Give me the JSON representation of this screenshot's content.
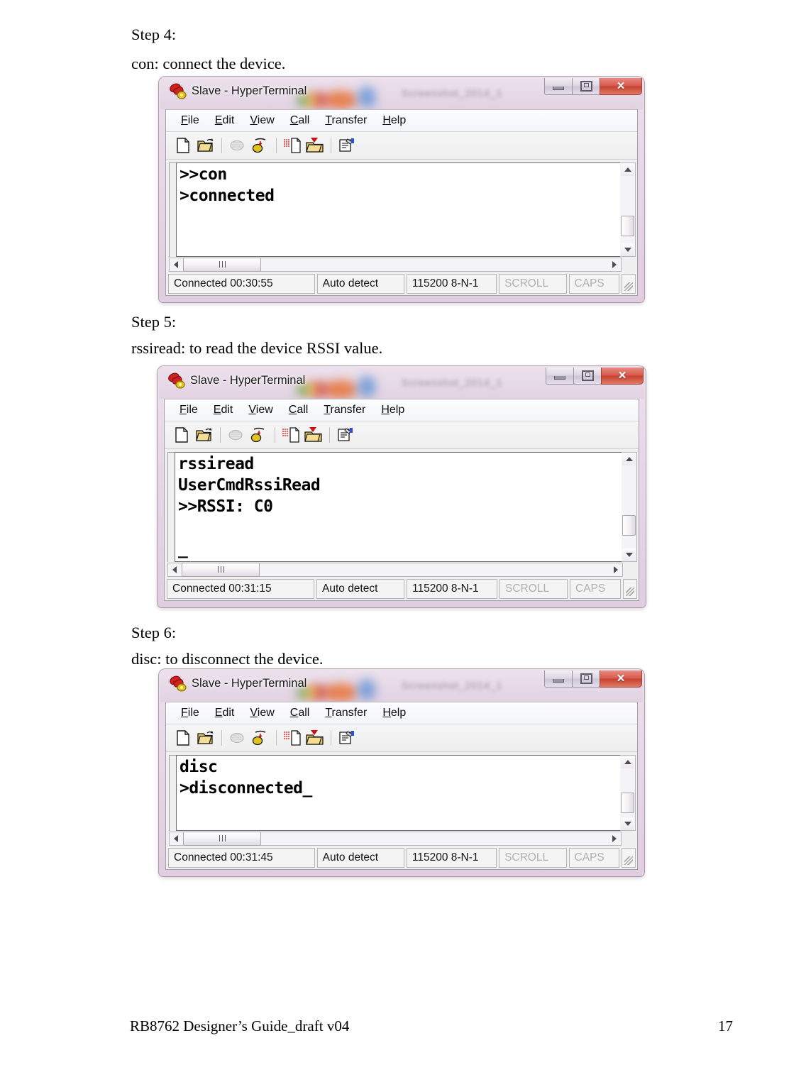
{
  "document": {
    "steps": [
      {
        "heading": "Step 4:",
        "description": "con: connect the device."
      },
      {
        "heading": "Step 5:",
        "description": "rssiread: to read the device RSSI value."
      },
      {
        "heading": "Step 6:",
        "description": "disc: to disconnect the device."
      }
    ],
    "footer": {
      "left": "RB8762 Designer’s Guide_draft v04",
      "page_number": "17"
    }
  },
  "window_common": {
    "title": "Slave - HyperTerminal",
    "title_icon": "phone-icon",
    "menus": [
      {
        "accel": "F",
        "rest": "ile",
        "name": "file"
      },
      {
        "accel": "E",
        "rest": "dit",
        "name": "edit"
      },
      {
        "accel": "V",
        "rest": "iew",
        "name": "view"
      },
      {
        "accel": "C",
        "rest": "all",
        "name": "call"
      },
      {
        "accel": "T",
        "rest": "ransfer",
        "name": "transfer"
      },
      {
        "accel": "H",
        "rest": "elp",
        "name": "help"
      }
    ],
    "toolbar_buttons": [
      {
        "name": "new-connection-icon",
        "title": "New"
      },
      {
        "name": "open-folder-icon",
        "title": "Open"
      },
      {
        "name": "disconnect-phone-icon",
        "title": "Disconnect"
      },
      {
        "name": "connect-phone-icon",
        "title": "Call"
      },
      {
        "name": "send-file-icon",
        "title": "Send"
      },
      {
        "name": "receive-file-icon",
        "title": "Receive"
      },
      {
        "name": "properties-icon",
        "title": "Properties"
      }
    ],
    "window_controls": [
      {
        "name": "minimize-button",
        "glyph": "minimize"
      },
      {
        "name": "restore-button",
        "glyph": "restore"
      },
      {
        "name": "close-button",
        "glyph": "×",
        "color": "#c6402f"
      }
    ],
    "status_fields": {
      "auto_detect": "Auto detect",
      "line_settings": "115200 8-N-1",
      "scroll": "SCROLL",
      "caps": "CAPS"
    },
    "blurred_titlebar_text": "Screenshot_2014_1"
  },
  "windows": [
    {
      "id": "window-step4",
      "terminal_lines": [
        ">>con",
        ">connected"
      ],
      "connected_time": "Connected 00:30:55"
    },
    {
      "id": "window-step5",
      "terminal_lines": [
        "rssiread",
        "UserCmdRssiRead",
        ">>RSSI: C0",
        "",
        "_"
      ],
      "connected_time": "Connected 00:31:15"
    },
    {
      "id": "window-step6",
      "terminal_lines": [
        "disc",
        ">disconnected_"
      ],
      "connected_time": "Connected 00:31:45"
    }
  ]
}
